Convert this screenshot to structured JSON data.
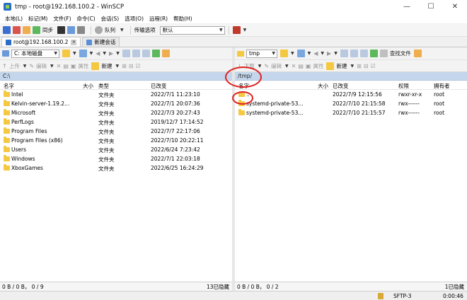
{
  "window": {
    "title": "tmp - root@192.168.100.2 - WinSCP",
    "min": "—",
    "max": "☐",
    "close": "✕"
  },
  "menu": [
    "本地(L)",
    "标记(M)",
    "文件(F)",
    "命令(C)",
    "会话(S)",
    "选项(O)",
    "远程(R)",
    "帮助(H)"
  ],
  "toolbar": {
    "sync_label": "同步",
    "queue_label": "队列",
    "transfer_label": "传输选项",
    "transfer_value": "默认"
  },
  "tabs": [
    {
      "label": "root@192.168.100.2",
      "close": "✕"
    },
    {
      "label": "新建会话"
    }
  ],
  "left": {
    "drive": "C: 本地磁盘",
    "toolbar2": {
      "upload": "上传",
      "edit": "编辑",
      "props": "属性",
      "new": "新建"
    },
    "path": "C:\\",
    "columns": {
      "name": "名字",
      "size": "大小",
      "type": "类型",
      "changed": "已改变"
    },
    "rows": [
      {
        "name": "Intel",
        "type": "文件夹",
        "changed": "2022/7/1   11:23:10"
      },
      {
        "name": "Kelvin-server-1.19.2...",
        "type": "文件夹",
        "changed": "2022/7/1   20:07:36"
      },
      {
        "name": "Microsoft",
        "type": "文件夹",
        "changed": "2022/7/3   20:27:43"
      },
      {
        "name": "PerfLogs",
        "type": "文件夹",
        "changed": "2019/12/7   17:14:52"
      },
      {
        "name": "Program Files",
        "type": "文件夹",
        "changed": "2022/7/7   22:17:06"
      },
      {
        "name": "Program Files (x86)",
        "type": "文件夹",
        "changed": "2022/7/10   20:22:11"
      },
      {
        "name": "Users",
        "type": "文件夹",
        "changed": "2022/6/24   7:23:42"
      },
      {
        "name": "Windows",
        "type": "文件夹",
        "changed": "2022/7/1   22:03:18"
      },
      {
        "name": "XboxGames",
        "type": "文件夹",
        "changed": "2022/6/25   16:24:29"
      }
    ],
    "status_left": "0 B / 0 B，  0 / 9",
    "status_right": "13已隐藏"
  },
  "right": {
    "folder": "tmp",
    "find_files": "查找文件",
    "toolbar2": {
      "download": "下载",
      "edit": "编辑",
      "props": "属性",
      "new": "新建"
    },
    "path": "/tmp/",
    "columns": {
      "name": "名字",
      "size": "大小",
      "changed": "已改变",
      "rights": "权限",
      "owner": "拥有者"
    },
    "rows": [
      {
        "name": "..",
        "changed": "2022/7/9 12:15:56",
        "rights": "rwxr-xr-x",
        "owner": "root",
        "parent": true
      },
      {
        "name": "systemd-private-53...",
        "changed": "2022/7/10 21:15:58",
        "rights": "rwx------",
        "owner": "root"
      },
      {
        "name": "systemd-private-53...",
        "changed": "2022/7/10 21:15:57",
        "rights": "rwx------",
        "owner": "root"
      }
    ],
    "status_left": "0 B / 0 B，  0 / 2",
    "status_right": "1已隐藏"
  },
  "statusbar": {
    "protocol": "SFTP-3",
    "timer": "0:00:46"
  },
  "colors": {
    "path_bg": "#c3d6ec",
    "folder": "#f5c842",
    "annotation": "#e02020"
  }
}
